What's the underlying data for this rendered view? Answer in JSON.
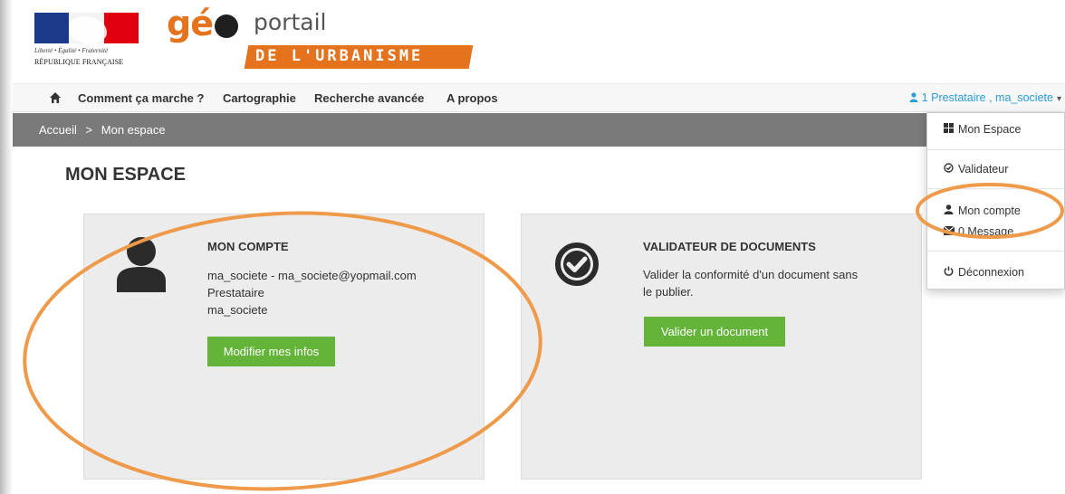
{
  "header": {
    "republic_motto": "Liberté • Égalité • Fraternité",
    "republic_name": "RÉPUBLIQUE FRANÇAISE",
    "logo_geo": "gé",
    "logo_portail": "portail",
    "logo_urbanisme": "DE L'URBANISME"
  },
  "navbar": {
    "home_icon": "home-icon",
    "items": [
      "Comment ça marche ?",
      "Cartographie",
      "Recherche avancée",
      "A propos"
    ],
    "user_label": "1 Prestataire , ma_societe",
    "user_icon": "user-icon"
  },
  "breadcrumb": {
    "home": "Accueil",
    "separator": ">",
    "current": "Mon espace"
  },
  "page": {
    "title": "MON ESPACE"
  },
  "cards": {
    "account": {
      "title": "MON COMPTE",
      "lines": [
        "ma_societe - ma_societe@yopmail.com",
        "Prestataire",
        "ma_societe"
      ],
      "button": "Modifier mes infos",
      "icon": "person-icon"
    },
    "validator": {
      "title": "VALIDATEUR DE DOCUMENTS",
      "lines": [
        "Valider la conformité d'un document sans",
        "le publier."
      ],
      "button": "Valider un document",
      "icon": "check-circle-icon"
    }
  },
  "dropdown": {
    "items": [
      {
        "label": "Mon Espace",
        "icon": "grid-icon"
      },
      {
        "label": "Validateur",
        "icon": "check-circle-icon"
      },
      {
        "label": "Mon compte",
        "icon": "user-icon"
      },
      {
        "label": "0 Message",
        "icon": "envelope-icon"
      },
      {
        "label": "Déconnexion",
        "icon": "power-icon"
      }
    ]
  },
  "colors": {
    "accent_orange": "#e5721c",
    "button_green": "#64b43a",
    "link_blue": "#2a9fd6",
    "breadcrumb_bg": "#7a7a7a",
    "card_bg": "#ececec",
    "annotation": "#ef9a4a"
  }
}
